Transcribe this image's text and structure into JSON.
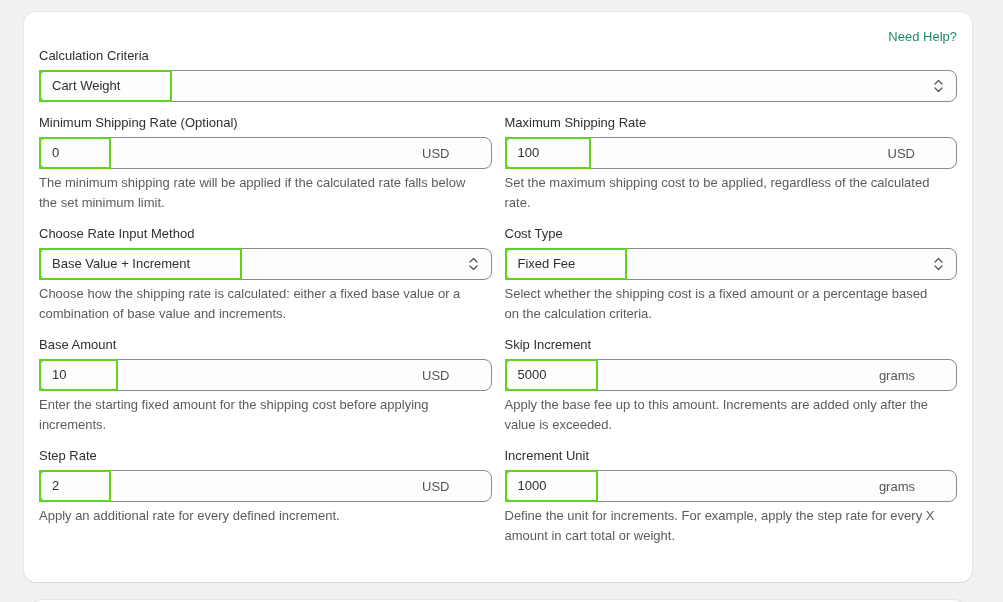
{
  "help_link": "Need Help?",
  "fields": [
    {
      "kind": "select",
      "full_width": true,
      "label": "Calculation Criteria",
      "value": "Cart Weight",
      "highlighted": true
    },
    {
      "kind": "input",
      "full_width": false,
      "label": "Minimum Shipping Rate (Optional)",
      "value": "0",
      "unit": "USD",
      "highlighted": true,
      "help": "The minimum shipping rate will be applied if the calculated rate falls below the set minimum limit."
    },
    {
      "kind": "input",
      "full_width": false,
      "label": "Maximum Shipping Rate",
      "value": "100",
      "unit": "USD",
      "highlighted": true,
      "help": "Set the maximum shipping cost to be applied, regardless of the calculated rate."
    },
    {
      "kind": "select",
      "full_width": false,
      "label": "Choose Rate Input Method",
      "value": "Base Value + Increment",
      "highlighted": true,
      "help": "Choose how the shipping rate is calculated: either a fixed base value or a combination of base value and increments."
    },
    {
      "kind": "select",
      "full_width": false,
      "label": "Cost Type",
      "value": "Fixed Fee",
      "highlighted": true,
      "help": "Select whether the shipping cost is a fixed amount or a percentage based on the calculation criteria."
    },
    {
      "kind": "input",
      "full_width": false,
      "label": "Base Amount",
      "value": "10",
      "unit": "USD",
      "highlighted": true,
      "help": "Enter the starting fixed amount for the shipping cost before applying increments."
    },
    {
      "kind": "input",
      "full_width": false,
      "label": "Skip Increment",
      "value": "5000",
      "unit": "grams",
      "highlighted": true,
      "help": "Apply the base fee up to this amount. Increments are added only after the value is exceeded."
    },
    {
      "kind": "input",
      "full_width": false,
      "label": "Step Rate",
      "value": "2",
      "unit": "USD",
      "highlighted": true,
      "help": "Apply an additional rate for every defined increment."
    },
    {
      "kind": "input",
      "full_width": false,
      "label": "Increment Unit",
      "value": "1000",
      "unit": "grams",
      "highlighted": true,
      "help": "Define the unit for increments. For example, apply the step rate for every X amount in cart total or weight."
    }
  ]
}
